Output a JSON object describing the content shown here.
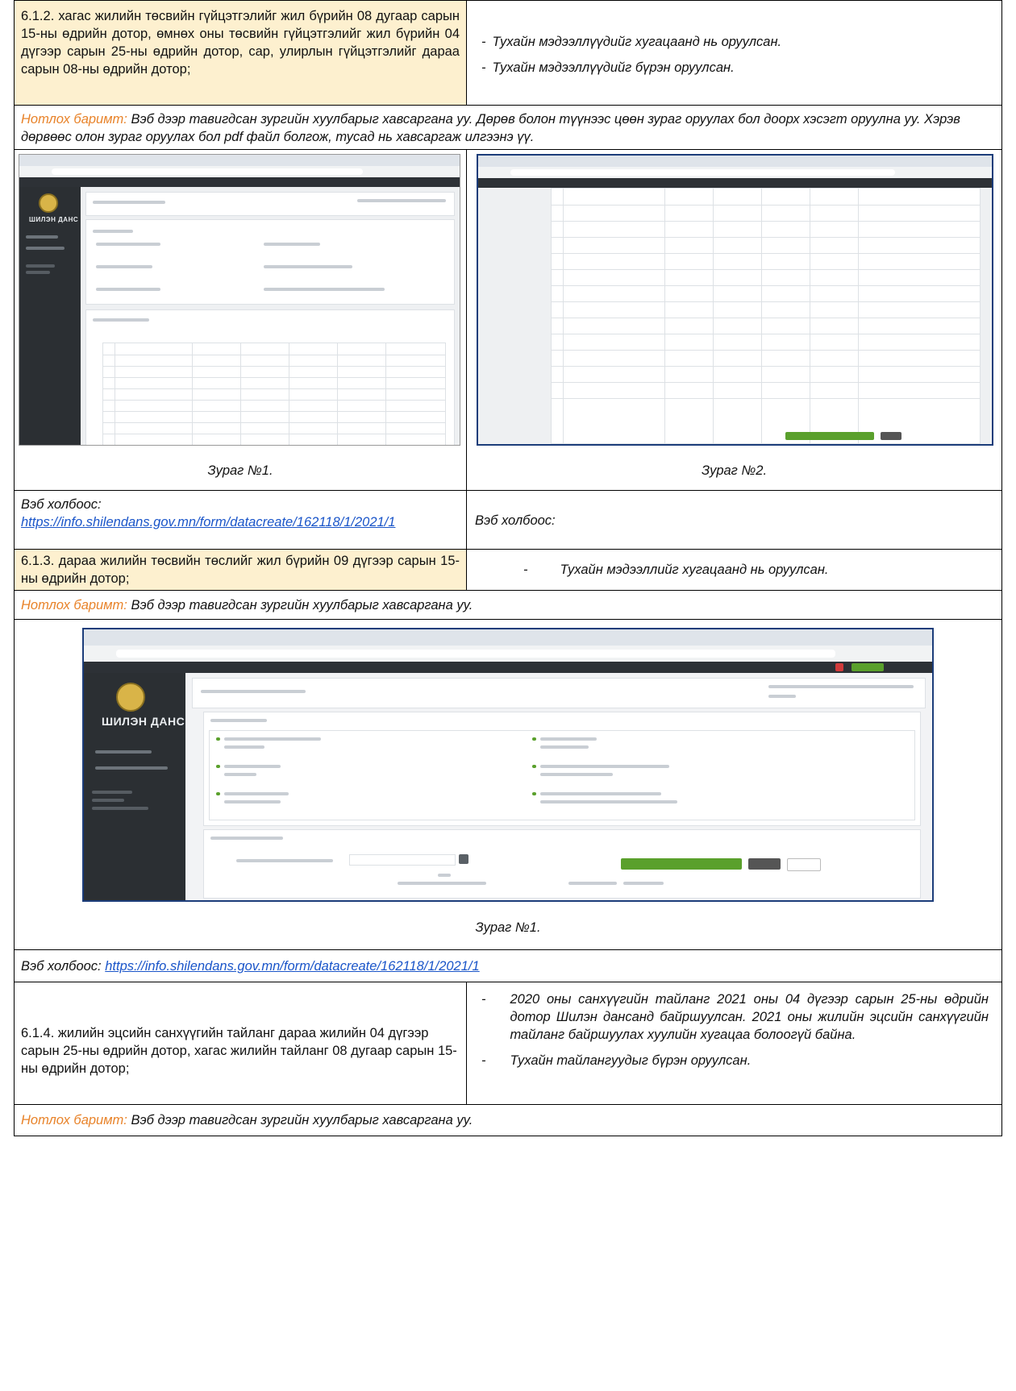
{
  "r1": {
    "left": "6.1.2. хагас жилийн төсвийн гүйцэтгэлийг жил бүрийн 08 дугаар сарын 15-ны өдрийн дотор, өмнөх оны төсвийн гүйцэтгэлийг жил бүрийн 04 дүгээр сарын 25-ны өдрийн дотор, сар, улирлын гүйцэтгэлийг дараа сарын 08-ны өдрийн дотор;",
    "bullets": [
      "Тухайн мэдээллүүдийг хугацаанд нь оруулсан.",
      "Тухайн мэдээллүүдийг бүрэн оруулсан."
    ]
  },
  "r2": {
    "label": "Нотлох баримт:",
    "text": " Вэб дээр тавигдсан зургийн хуулбарыг хавсаргана уу. Дөрөв болон түүнээс цөөн зураг оруулах бол доорх хэсэгт оруулна уу. Хэрэв дөрвөөс олон зураг оруулах бол pdf файл болгож, тусад нь хавсаргаж илгээнэ үү."
  },
  "r3": {
    "caption1": "Зураг №1.",
    "caption2": "Зураг №2."
  },
  "r4": {
    "label_left": "Вэб холбоос:",
    "link": "https://info.shilendans.gov.mn/form/datacreate/162118/1/2021/1",
    "label_right": "Вэб холбоос:"
  },
  "r5": {
    "left": "6.1.3. дараа жилийн төсвийн төслийг жил бүрийн 09 дүгээр сарын 15-ны өдрийн дотор;",
    "bullet": "Тухайн мэдээллийг хугацаанд нь оруулсан."
  },
  "r6": {
    "label": "Нотлох баримт:",
    "text": " Вэб дээр тавигдсан зургийн хуулбарыг хавсаргана уу."
  },
  "r7": {
    "caption": "Зураг №1.",
    "side_title": "ШИЛЭН ДАНС"
  },
  "r8": {
    "label": "Вэб холбоос:",
    "link": "https://info.shilendans.gov.mn/form/datacreate/162118/1/2021/1"
  },
  "r9": {
    "left": "6.1.4. жилийн эцсийн санхүүгийн тайланг дараа жилийн 04 дүгээр сарын 25-ны өдрийн дотор, хагас жилийн тайланг 08 дугаар сарын 15-ны өдрийн дотор;",
    "bullets": [
      "2020 оны санхүүгийн тайланг 2021 оны 04 дүгээр сарын 25-ны өдрийн дотор Шилэн дансанд байршуулсан. 2021 оны жилийн эцсийн санхүүгийн тайланг байршуулах хуулийн хугацаа болоогүй байна.",
      "Тухайн тайлангуудыг бүрэн оруулсан."
    ]
  },
  "r10": {
    "label": "Нотлох баримт:",
    "text": " Вэб дээр тавигдсан зургийн хуулбарыг хавсаргана уу."
  },
  "icons": {
    "emblem": "emblem-icon",
    "dash": "dash-bullet"
  }
}
